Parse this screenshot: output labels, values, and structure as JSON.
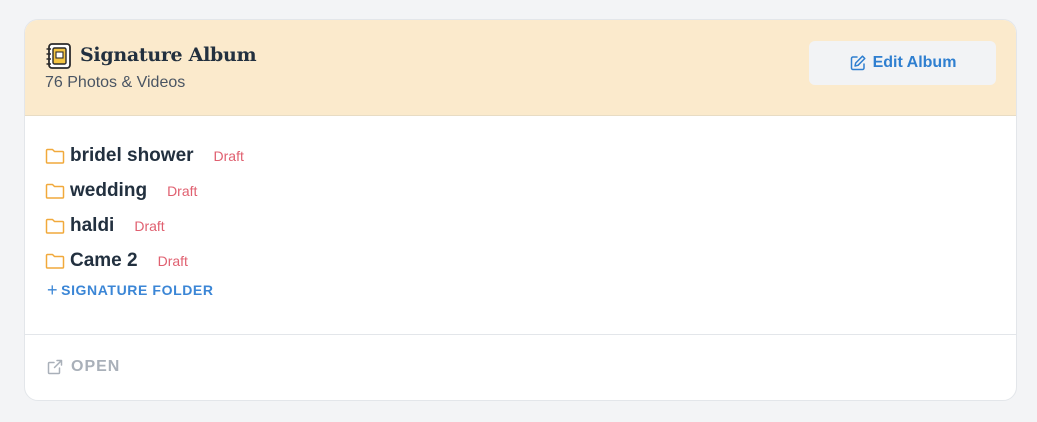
{
  "album": {
    "title": "Signature Album",
    "subtitle": "76 Photos & Videos",
    "icon": "album-book-icon"
  },
  "header": {
    "edit_button_label": "Edit Album",
    "edit_icon": "edit-icon"
  },
  "folders": [
    {
      "name": "bridel shower",
      "status": "Draft"
    },
    {
      "name": "wedding",
      "status": "Draft"
    },
    {
      "name": "haldi",
      "status": "Draft"
    },
    {
      "name": "Came 2",
      "status": "Draft"
    }
  ],
  "add_folder": {
    "plus": "+",
    "label": "SIGNATURE FOLDER"
  },
  "footer": {
    "open_label": "OPEN",
    "open_icon": "external-link-icon"
  },
  "colors": {
    "header_bg": "#fbeacc",
    "accent_blue": "#2f7fd0",
    "draft_red": "#e06070",
    "folder_orange": "#f1a93b"
  }
}
